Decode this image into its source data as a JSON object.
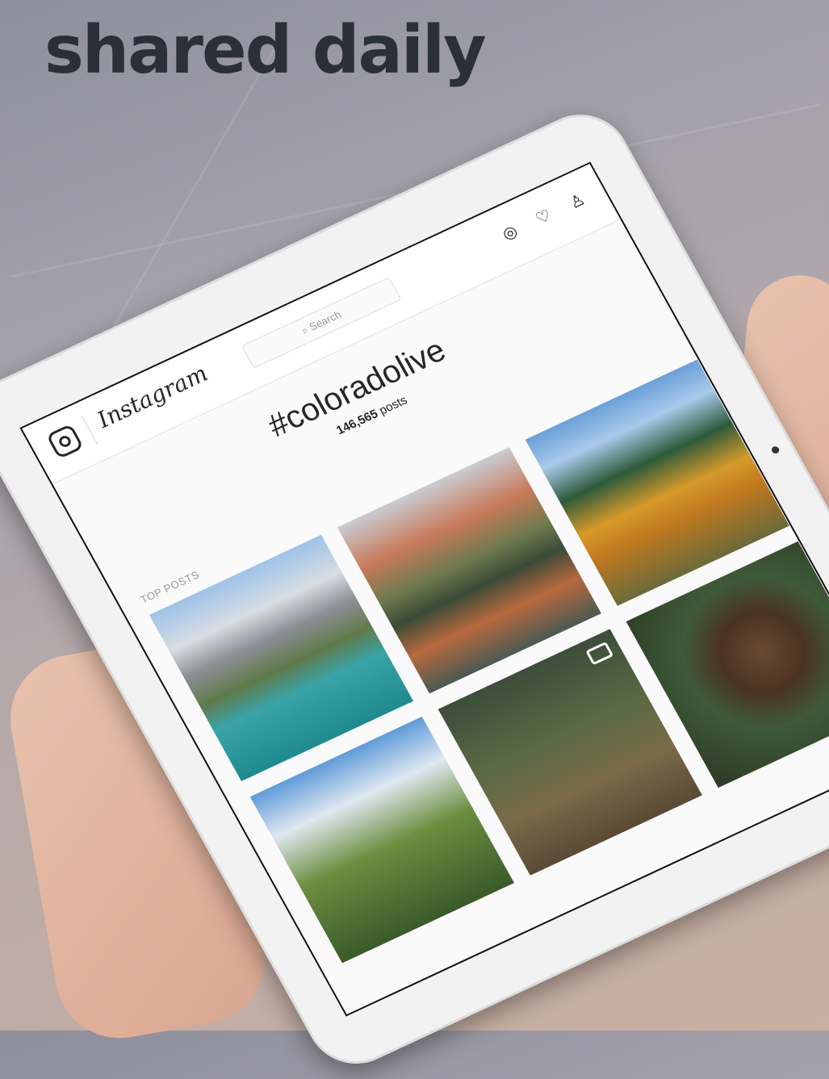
{
  "headline": "shared daily",
  "app": {
    "wordmark": "Instagram",
    "search_placeholder": "Search",
    "nav_icons": [
      "explore-compass-icon",
      "heart-icon",
      "profile-icon"
    ]
  },
  "hashtag": {
    "title": "#coloradolive",
    "post_count": "146,565",
    "post_label": "posts"
  },
  "section_label": "TOP POSTS",
  "posts": [
    {
      "subject": "mountain-lake"
    },
    {
      "subject": "maroon-bells-reflection"
    },
    {
      "subject": "autumn-aspens"
    },
    {
      "subject": "forest-sky"
    },
    {
      "subject": "hiker-valley",
      "video": true
    },
    {
      "subject": "dog-portrait"
    }
  ],
  "colors": {
    "headline": "#2b2f37",
    "tablet_bezel": "#f2f2f2",
    "screen_bg": "#fafafa"
  }
}
